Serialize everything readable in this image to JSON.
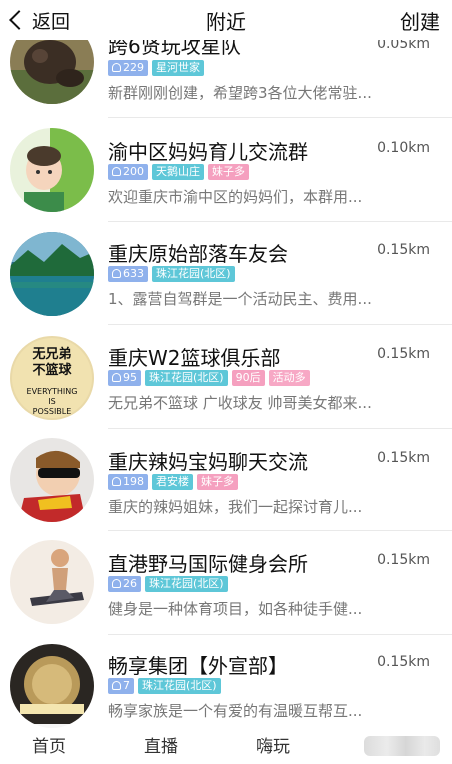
{
  "header": {
    "back_label": "返回",
    "title": "附近",
    "create_label": "创建"
  },
  "groups": [
    {
      "name": "跨6贤玩攻星队",
      "distance": "0.05km",
      "members": "229",
      "tags": [
        "星河世家"
      ],
      "description": "新群刚刚创建，希望跨3各位大佬常驻..."
    },
    {
      "name": "渝中区妈妈育儿交流群",
      "distance": "0.10km",
      "members": "200",
      "tags": [
        "天鹅山庄",
        "妹子多"
      ],
      "description": "欢迎重庆市渝中区的妈妈们，本群用..."
    },
    {
      "name": "重庆原始部落车友会",
      "distance": "0.15km",
      "members": "633",
      "tags": [
        "珠江花园(北区)"
      ],
      "description": "1、露营自驾群是一个活动民主、费用..."
    },
    {
      "name": "重庆W2篮球俱乐部",
      "distance": "0.15km",
      "members": "95",
      "tags": [
        "珠江花园(北区)",
        "90后",
        "活动多"
      ],
      "description": "无兄弟不篮球 广收球友 帅哥美女都来...",
      "avatar_text": [
        "无兄弟",
        "不篮球",
        "EVERYTHING",
        "IS",
        "POSSIBLE"
      ]
    },
    {
      "name": "重庆辣妈宝妈聊天交流",
      "distance": "0.15km",
      "members": "198",
      "tags": [
        "君安楼",
        "妹子多"
      ],
      "description": "重庆的辣妈姐妹，我们一起探讨育儿..."
    },
    {
      "name": "直港野马国际健身会所",
      "distance": "0.15km",
      "members": "26",
      "tags": [
        "珠江花园(北区)"
      ],
      "description": "健身是一种体育项目，如各种徒手健..."
    },
    {
      "name": "畅享集团【外宣部】",
      "distance": "0.15km",
      "members": "7",
      "tags": [
        "珠江花园(北区)"
      ],
      "description": "畅享家族是一个有爱的有温暖互帮互..."
    }
  ],
  "bottom_nav": {
    "home": "首页",
    "live": "直播",
    "fun": "嗨玩"
  },
  "colors": {
    "member_tag": "#8fb1ec",
    "location_tag": "#5ec7d8",
    "pink_tag": "#f5a0bf"
  }
}
